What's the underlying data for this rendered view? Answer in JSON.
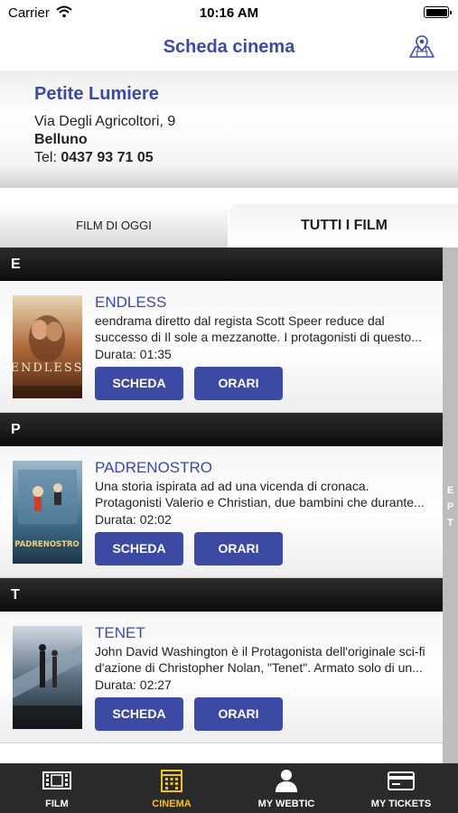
{
  "status": {
    "carrier": "Carrier",
    "time": "10:16 AM"
  },
  "nav": {
    "title": "Scheda cinema",
    "map_icon": "map-location-icon"
  },
  "cinema": {
    "name": "Petite Lumiere",
    "address": "Via Degli Agricoltori, 9",
    "city": "Belluno",
    "tel_label": "Tel:",
    "tel_number": "0437 93 71 05"
  },
  "tabs": {
    "today": "FILM DI OGGI",
    "all": "TUTTI I FILM",
    "active": "all"
  },
  "sections": [
    {
      "letter": "E",
      "film": {
        "title": "ENDLESS",
        "desc1": "eendrama diretto dal regista Scott Speer reduce dal",
        "desc2": "successo di Il sole a mezzanotte. I protagonisti di questo...",
        "duration": "Durata: 01:35",
        "scheda": "SCHEDA",
        "orari": "ORARI"
      }
    },
    {
      "letter": "P",
      "film": {
        "title": "PADRENOSTRO",
        "desc1": "Una storia ispirata ad ad una vicenda di cronaca.",
        "desc2": "Protagonisti Valerio e Christian, due bambini che durante...",
        "duration": "Durata: 02:02",
        "scheda": "SCHEDA",
        "orari": "ORARI"
      }
    },
    {
      "letter": "T",
      "film": {
        "title": "TENET",
        "desc1": "John David Washington è il Protagonista dell'originale sci-fi",
        "desc2": "d'azione di Christopher Nolan, \"Tenet\". Armato solo di un...",
        "duration": "Durata: 02:27",
        "scheda": "SCHEDA",
        "orari": "ORARI"
      }
    }
  ],
  "index": {
    "letters": [
      "E",
      "P",
      "T"
    ]
  },
  "tabbar": [
    {
      "label": "FILM",
      "icon": "film-strip-icon",
      "active": false
    },
    {
      "label": "CINEMA",
      "icon": "cinema-building-icon",
      "active": true
    },
    {
      "label": "MY WEBTIC",
      "icon": "user-icon",
      "active": false
    },
    {
      "label": "MY TICKETS",
      "icon": "credit-card-icon",
      "active": false
    }
  ],
  "colors": {
    "brand_blue": "#3d4aa3",
    "active_tab_yellow": "#f0c419",
    "tabbar_bg": "#2a2a2a"
  }
}
